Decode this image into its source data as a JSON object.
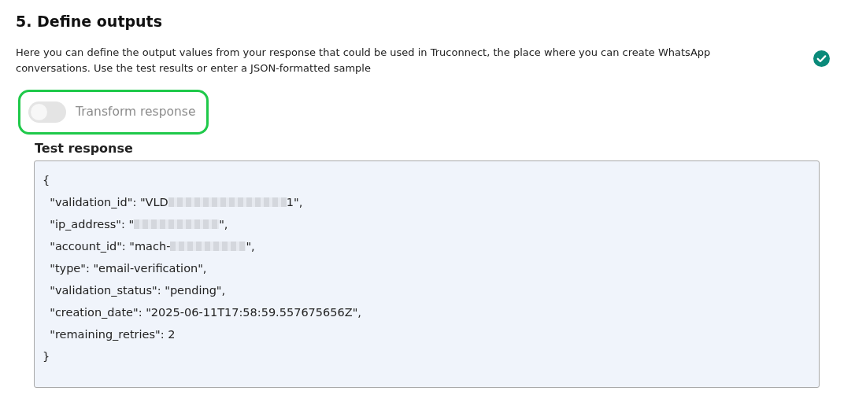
{
  "section": {
    "title": "5. Define outputs",
    "description": "Here you can define the output values from your response that could be used in Truconnect, the place where you can create WhatsApp conversations. Use the test results or enter a JSON-formatted sample",
    "completed": true
  },
  "transform_toggle": {
    "label": "Transform response",
    "on": false,
    "disabled": true,
    "highlighted": true
  },
  "test_response": {
    "label": "Test response",
    "lines": [
      {
        "text": "{"
      },
      {
        "text": "  \"validation_id\": \"VLD",
        "redacted": true,
        "tail": "1\","
      },
      {
        "text": "  \"ip_address\": \"",
        "redacted": true,
        "tail": "\","
      },
      {
        "text": "  \"account_id\": \"mach-",
        "redacted": true,
        "tail": "\","
      },
      {
        "text": "  \"type\": \"email-verification\","
      },
      {
        "text": "  \"validation_status\": \"pending\","
      },
      {
        "text": "  \"creation_date\": \"2025-06-11T17:58:59.557675656Z\","
      },
      {
        "text": "  \"remaining_retries\": 2"
      },
      {
        "text": "}"
      }
    ]
  }
}
